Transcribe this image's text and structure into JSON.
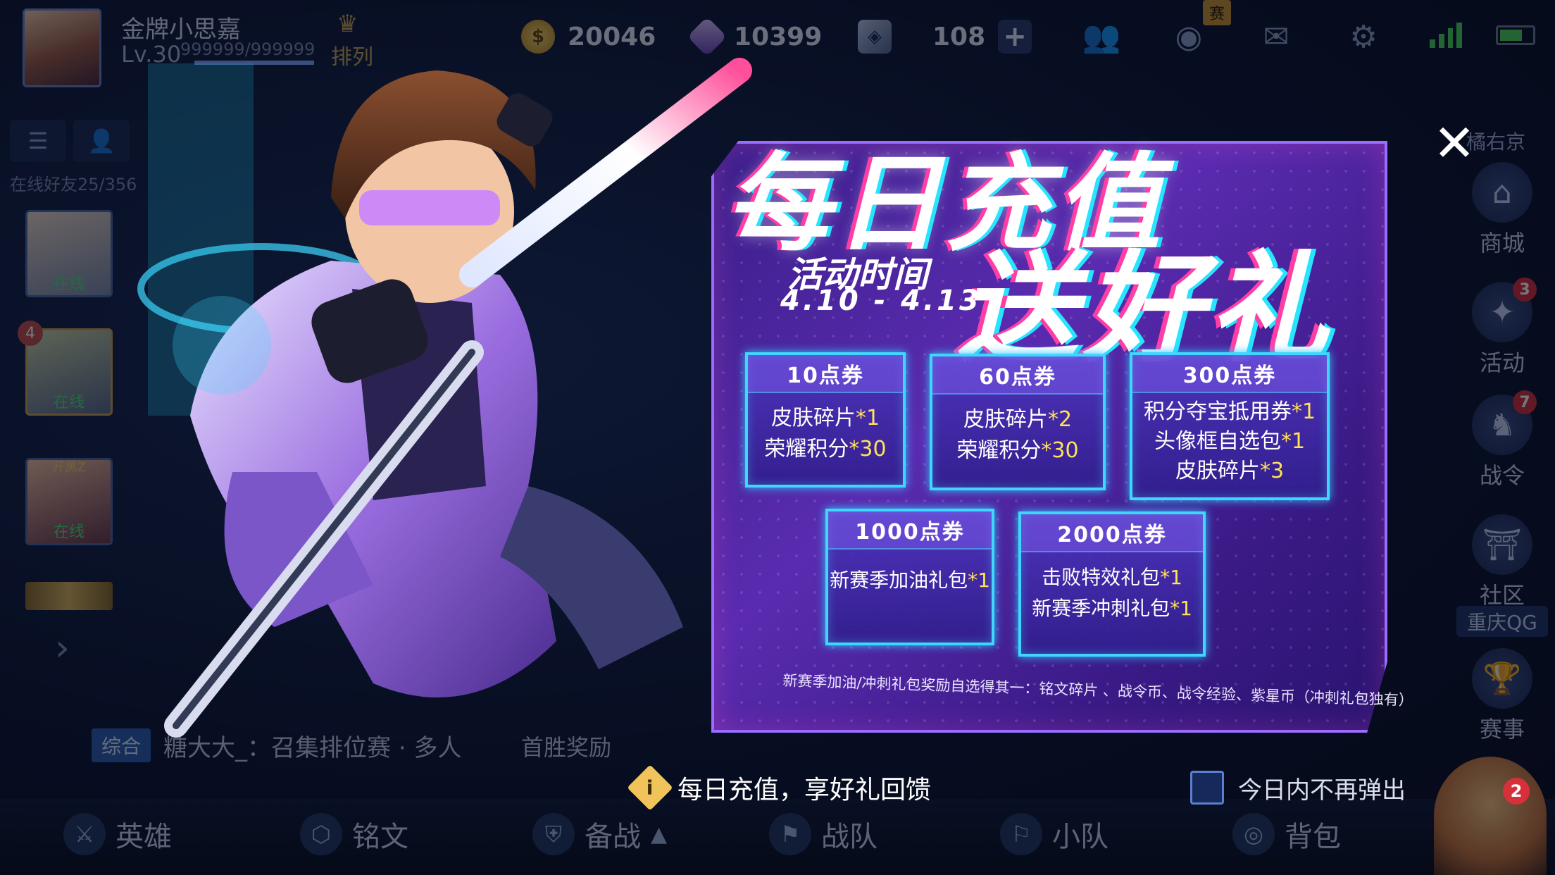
{
  "player": {
    "name": "金牌小思嘉",
    "level": "Lv.30",
    "exp": "999999/999999",
    "exp_fraction": 1.0,
    "rank_label": "排列"
  },
  "currencies": {
    "gold": "20046",
    "diamond": "10399",
    "coupon": "108"
  },
  "icons": {
    "friends": "friends-icon",
    "replay": "replay-icon",
    "mail": "mail-icon",
    "settings": "settings-icon",
    "replay_tag": "赛"
  },
  "friends_panel": {
    "count_label": "在线好友25/356",
    "friends": [
      {
        "status": "在线"
      },
      {
        "status": "在线",
        "badge": "4"
      },
      {
        "status": "在线",
        "tag": "开黑Z"
      }
    ]
  },
  "right_nav": {
    "top_tag": "橘右京",
    "items": [
      {
        "label": "商城",
        "badge": ""
      },
      {
        "label": "活动",
        "badge": "3"
      },
      {
        "label": "战令",
        "badge": "7"
      },
      {
        "label": "社区",
        "badge": ""
      },
      {
        "label": "赛事",
        "badge": ""
      }
    ],
    "team_tag": "重庆QG"
  },
  "chat": {
    "tab": "综合",
    "message": "糖大大_：召集排位赛 · 多人",
    "first_win": "首胜奖励"
  },
  "bottom_nav": [
    {
      "label": "英雄"
    },
    {
      "label": "铭文"
    },
    {
      "label": "备战"
    },
    {
      "label": "战队"
    },
    {
      "label": "小队"
    },
    {
      "label": "背包"
    }
  ],
  "corner_badge": "2",
  "popup": {
    "title_line1": "每日充值",
    "title_line2": "送好礼",
    "activity_label": "活动时间",
    "activity_dates": "4.10 - 4.13",
    "tiers": [
      {
        "title": "10点券",
        "rewards": [
          {
            "name": "皮肤碎片",
            "qty": "*1"
          },
          {
            "name": "荣耀积分",
            "qty": "*30"
          }
        ]
      },
      {
        "title": "60点券",
        "rewards": [
          {
            "name": "皮肤碎片",
            "qty": "*2"
          },
          {
            "name": "荣耀积分",
            "qty": "*30"
          }
        ]
      },
      {
        "title": "300点券",
        "rewards": [
          {
            "name": "积分夺宝抵用券",
            "qty": "*1"
          },
          {
            "name": "头像框自选包",
            "qty": "*1"
          },
          {
            "name": "皮肤碎片",
            "qty": "*3"
          }
        ]
      },
      {
        "title": "1000点券",
        "rewards": [
          {
            "name": "新赛季加油礼包",
            "qty": "*1"
          }
        ]
      },
      {
        "title": "2000点券",
        "rewards": [
          {
            "name": "击败特效礼包",
            "qty": "*1"
          },
          {
            "name": "新赛季冲刺礼包",
            "qty": "*1"
          }
        ]
      }
    ],
    "footnote": "新赛季加油/冲刺礼包奖励自选得其一：铭文碎片 、战令币、战令经验、紫星币（冲刺礼包独有）",
    "close_symbol": "✕",
    "tip_text": "每日充值，享好礼回馈",
    "dont_show_label": "今日内不再弹出"
  }
}
